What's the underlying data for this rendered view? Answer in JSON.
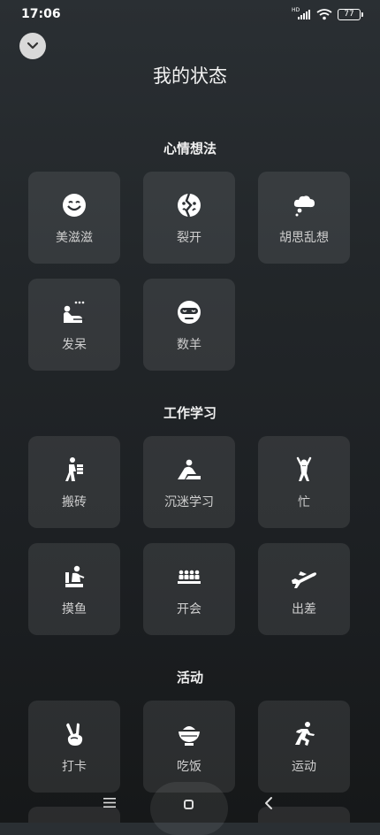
{
  "status_bar": {
    "time": "17:06",
    "signal_label": "HD",
    "battery": "77"
  },
  "header": {
    "title": "我的状态"
  },
  "sections": [
    {
      "title": "心情想法",
      "items": [
        {
          "label": "美滋滋",
          "icon": "smiley-face-icon"
        },
        {
          "label": "裂开",
          "icon": "cracked-face-icon"
        },
        {
          "label": "胡思乱想",
          "icon": "thought-cloud-icon"
        },
        {
          "label": "发呆",
          "icon": "daydream-person-icon"
        },
        {
          "label": "数羊",
          "icon": "sleep-mask-icon"
        }
      ]
    },
    {
      "title": "工作学习",
      "items": [
        {
          "label": "搬砖",
          "icon": "carrying-bricks-icon"
        },
        {
          "label": "沉迷学习",
          "icon": "studying-person-icon"
        },
        {
          "label": "忙",
          "icon": "busy-person-icon"
        },
        {
          "label": "摸鱼",
          "icon": "slacking-person-icon"
        },
        {
          "label": "开会",
          "icon": "meeting-people-icon"
        },
        {
          "label": "出差",
          "icon": "airplane-icon"
        }
      ]
    },
    {
      "title": "活动",
      "items": [
        {
          "label": "打卡",
          "icon": "victory-hand-icon"
        },
        {
          "label": "吃饭",
          "icon": "rice-bowl-icon"
        },
        {
          "label": "运动",
          "icon": "running-person-icon"
        }
      ]
    }
  ],
  "nav": {
    "menu": "menu-icon",
    "home": "home-icon",
    "back": "back-icon"
  }
}
